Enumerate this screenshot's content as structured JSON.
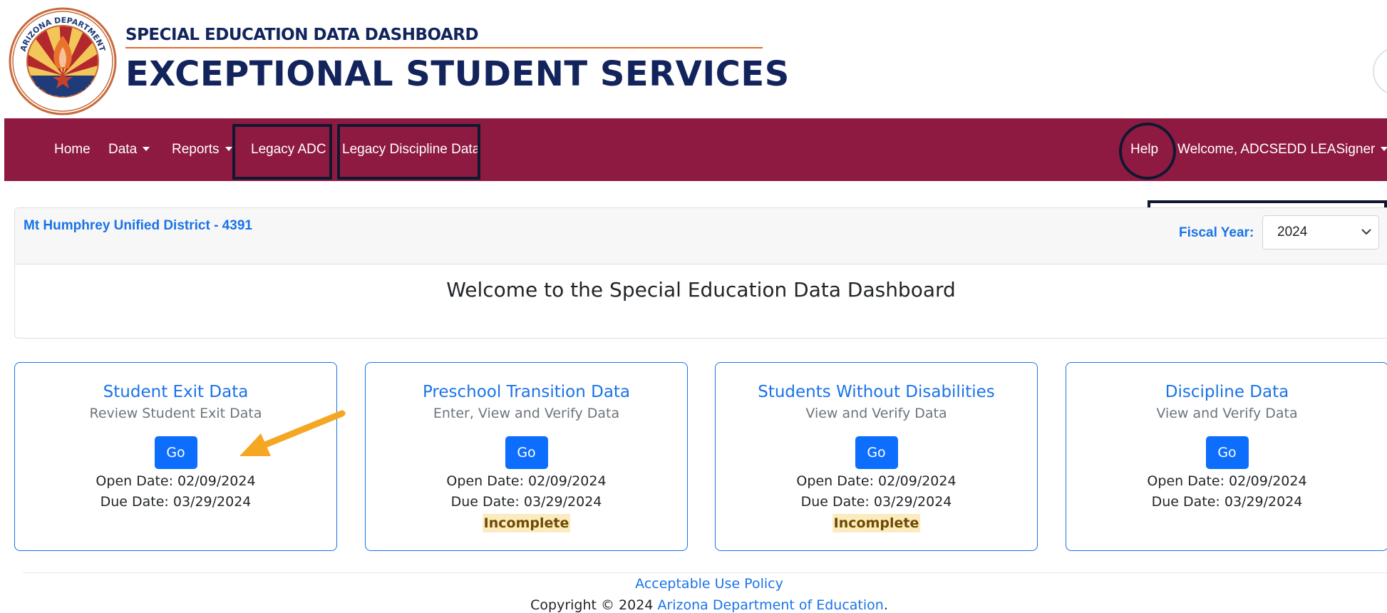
{
  "header": {
    "logo_text": "ARIZONA DEPARTMENT OF EDUCATION",
    "subtitle": "SPECIAL EDUCATION DATA DASHBOARD",
    "title": "EXCEPTIONAL STUDENT SERVICES"
  },
  "nav": {
    "items": [
      {
        "label": "Home"
      },
      {
        "label": "Data"
      },
      {
        "label": "Reports"
      },
      {
        "label": "Legacy ADC"
      },
      {
        "label": "Legacy Discipline Data"
      }
    ],
    "help": "Help",
    "user": "Welcome, ADCSEDD LEASigner",
    "background": "#8e1a42"
  },
  "district": {
    "name": "Mt Humphrey Unified District - 4391",
    "fiscal_label": "Fiscal Year:",
    "fiscal_value": "2024"
  },
  "welcome": "Welcome to the Special Education Data Dashboard",
  "cards": [
    {
      "title": "Student Exit Data",
      "subtitle": "Review Student Exit Data",
      "button": "Go",
      "open": "Open Date: 02/09/2024",
      "due": "Due Date: 03/29/2024",
      "status": ""
    },
    {
      "title": "Preschool Transition Data",
      "subtitle": "Enter, View and Verify Data",
      "button": "Go",
      "open": "Open Date: 02/09/2024",
      "due": "Due Date: 03/29/2024",
      "status": "Incomplete"
    },
    {
      "title": "Students Without Disabilities",
      "subtitle": "View and Verify Data",
      "button": "Go",
      "open": "Open Date: 02/09/2024",
      "due": "Due Date: 03/29/2024",
      "status": "Incomplete"
    },
    {
      "title": "Discipline Data",
      "subtitle": "View and Verify Data",
      "button": "Go",
      "open": "Open Date: 02/09/2024",
      "due": "Due Date: 03/29/2024",
      "status": ""
    }
  ],
  "footer": {
    "policy": "Acceptable Use Policy",
    "copyright_prefix": "Copyright © 2024",
    "org": "Arizona Department of Education",
    "suffix": "."
  },
  "colors": {
    "accent": "#1a73e8",
    "button": "#0d6efd",
    "navy": "#13245c",
    "annotation_arrow": "#f5a623"
  }
}
